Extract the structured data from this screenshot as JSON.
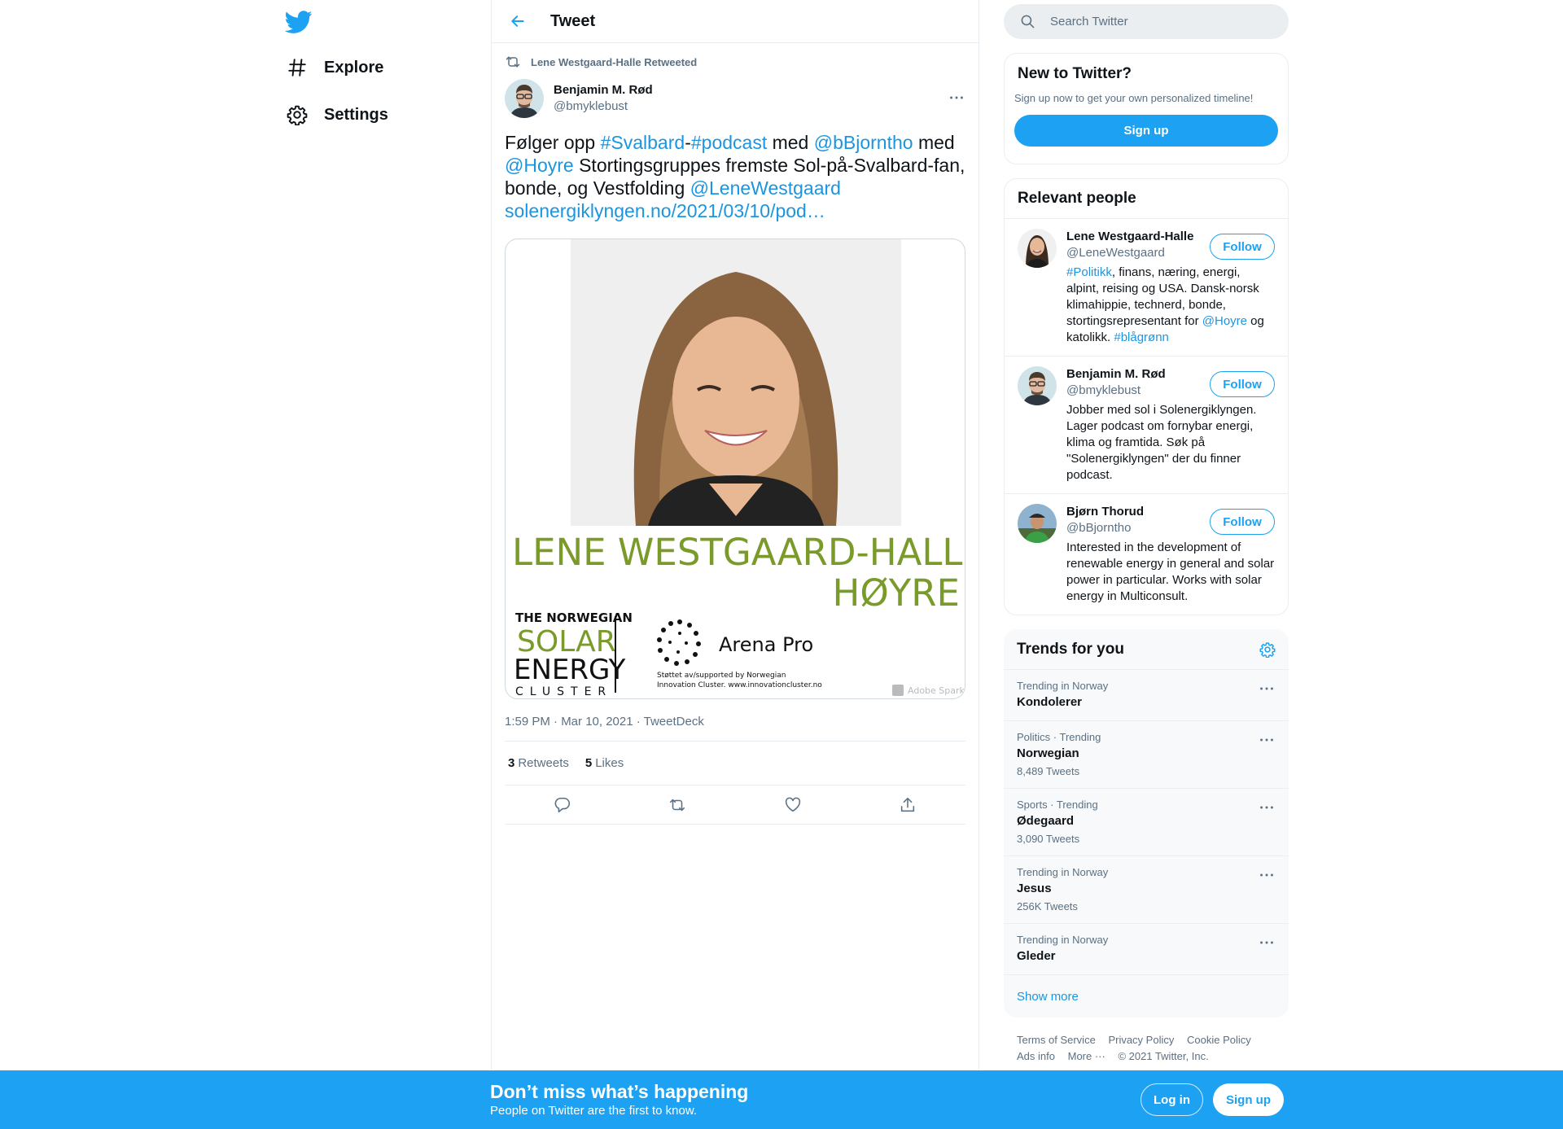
{
  "nav": {
    "logo_icon": "twitter-bird-icon",
    "items": [
      {
        "label": "Explore",
        "icon": "hashtag-icon"
      },
      {
        "label": "Settings",
        "icon": "gear-icon"
      }
    ]
  },
  "main": {
    "title": "Tweet",
    "retweeted_by": "Lene Westgaard-Halle Retweeted",
    "author": {
      "name": "Benjamin M. Rød",
      "handle": "@bmyklebust"
    },
    "text": {
      "p1": "Følger opp ",
      "tag1": "#Svalbard",
      "dash": "-",
      "tag2": "#podcast",
      "p2": " med ",
      "mention1": "@bBjorntho",
      "p3": " med ",
      "mention2": "@Hoyre",
      "p4": " Stortingsgruppes fremste Sol-på-Svalbard-fan, bonde, og Vestfolding  ",
      "mention3": "@LeneWestgaard",
      "url": "solenergiklyngen.no/2021/03/10/pod…"
    },
    "media": {
      "name_line": "LENE WESTGAARD-HALLE",
      "party_line": "HØYRE",
      "cluster_line1": "THE NORWEGIAN",
      "cluster_line2": "SOLAR",
      "cluster_line3": "ENERGY",
      "cluster_line4": "CLUSTER",
      "arena": "Arena Pro",
      "supported1": "Støttet av/supported by Norwegian",
      "supported2": "Innovation Cluster. www.innovationcluster.no",
      "watermark": "Adobe Spark"
    },
    "meta": "1:59 PM · Mar 10, 2021 · TweetDeck",
    "retweets_count": "3",
    "retweets_label": "Retweets",
    "likes_count": "5",
    "likes_label": "Likes"
  },
  "sidebar": {
    "search_placeholder": "Search Twitter",
    "new_title": "New to Twitter?",
    "new_sub": "Sign up now to get your own personalized timeline!",
    "signup": "Sign up",
    "relevant_title": "Relevant people",
    "people": [
      {
        "name": "Lene Westgaard-Halle",
        "handle": "@LeneWestgaard",
        "follow": "Follow",
        "bio_tag1": "#Politikk",
        "bio_p1": ", finans, næring, energi, alpint, reising og USA. Dansk-norsk klimahippie, technerd, bonde, stortingsrepresentant for ",
        "bio_mention": "@Hoyre",
        "bio_p2": " og katolikk. ",
        "bio_tag2": "#blågrønn"
      },
      {
        "name": "Benjamin M. Rød",
        "handle": "@bmyklebust",
        "follow": "Follow",
        "bio": "Jobber med sol i Solenergiklyngen. Lager podcast om fornybar energi, klima og framtida. Søk på \"Solenergiklyngen\" der du finner podcast."
      },
      {
        "name": "Bjørn Thorud",
        "handle": "@bBjorntho",
        "follow": "Follow",
        "bio": "Interested in the development of renewable energy in general and solar power in particular. Works with solar energy in Multiconsult."
      }
    ],
    "trends_title": "Trends for you",
    "trends": [
      {
        "context": "Trending in Norway",
        "name": "Kondolerer",
        "count": ""
      },
      {
        "context": "Politics · Trending",
        "name": "Norwegian",
        "count": "8,489 Tweets"
      },
      {
        "context": "Sports · Trending",
        "name": "Ødegaard",
        "count": "3,090 Tweets"
      },
      {
        "context": "Trending in Norway",
        "name": "Jesus",
        "count": "256K Tweets"
      },
      {
        "context": "Trending in Norway",
        "name": "Gleder",
        "count": ""
      }
    ],
    "show_more": "Show more",
    "footer": {
      "terms": "Terms of Service",
      "privacy": "Privacy Policy",
      "cookie": "Cookie Policy",
      "ads": "Ads info",
      "more": "More ···",
      "copyright": "© 2021 Twitter, Inc."
    }
  },
  "bottom_bar": {
    "title": "Don’t miss what’s happening",
    "subtitle": "People on Twitter are the first to know.",
    "login": "Log in",
    "signup": "Sign up"
  },
  "colors": {
    "accent": "#1da1f2",
    "link": "#1b95e0",
    "media_green": "#7a9a2a"
  }
}
